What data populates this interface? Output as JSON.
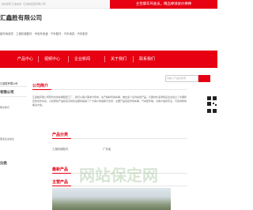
{
  "topbar": {
    "welcome": "欢迎来到 汇金在线（汇金供应链有限公司）",
    "promo": "主营康车驾驶员，精品棒球驶价棒棒"
  },
  "brand": {
    "title": "汇鑫胜有限公司",
    "description": "康车驾驶员 · 工程机械配件 · 专用车底盘 · 汽车配件 · 汽车用具 · 汽车配件"
  },
  "nav": {
    "items": [
      "产品中心",
      "视频中心",
      "企业新闻",
      "关于我们",
      "联系我们"
    ]
  },
  "left": {
    "title": "汇鑫胜有限公司",
    "contact_head": "联系我们",
    "company": "有限公司",
    "badge": "更多企业信息",
    "side_head": "分类"
  },
  "search": {
    "placeholder": "请输入产品名搜索"
  },
  "about": {
    "title": "公司简介",
    "text": "汇鑫胜有限公司现代化的车辆装配工厂，我们以客户需求为导向，生产各种专用车辆，推出多个系列车型产品，与国内外多家知名企业建立了长期稳定的合作关系，以优质的产品和完善的售后服务赢得了广大客户的信赖与支持，主要产品包括专用车辆、汽车配件等，为客户提供专业、可靠的整体解决方案。"
  },
  "categories": {
    "title": "产品分类",
    "items": [
      "工程机械配件",
      "广东省"
    ]
  },
  "latest": {
    "title": "最新产品"
  },
  "main_products": {
    "title": "主营产品"
  },
  "watermark": {
    "text": "网站保定网"
  }
}
